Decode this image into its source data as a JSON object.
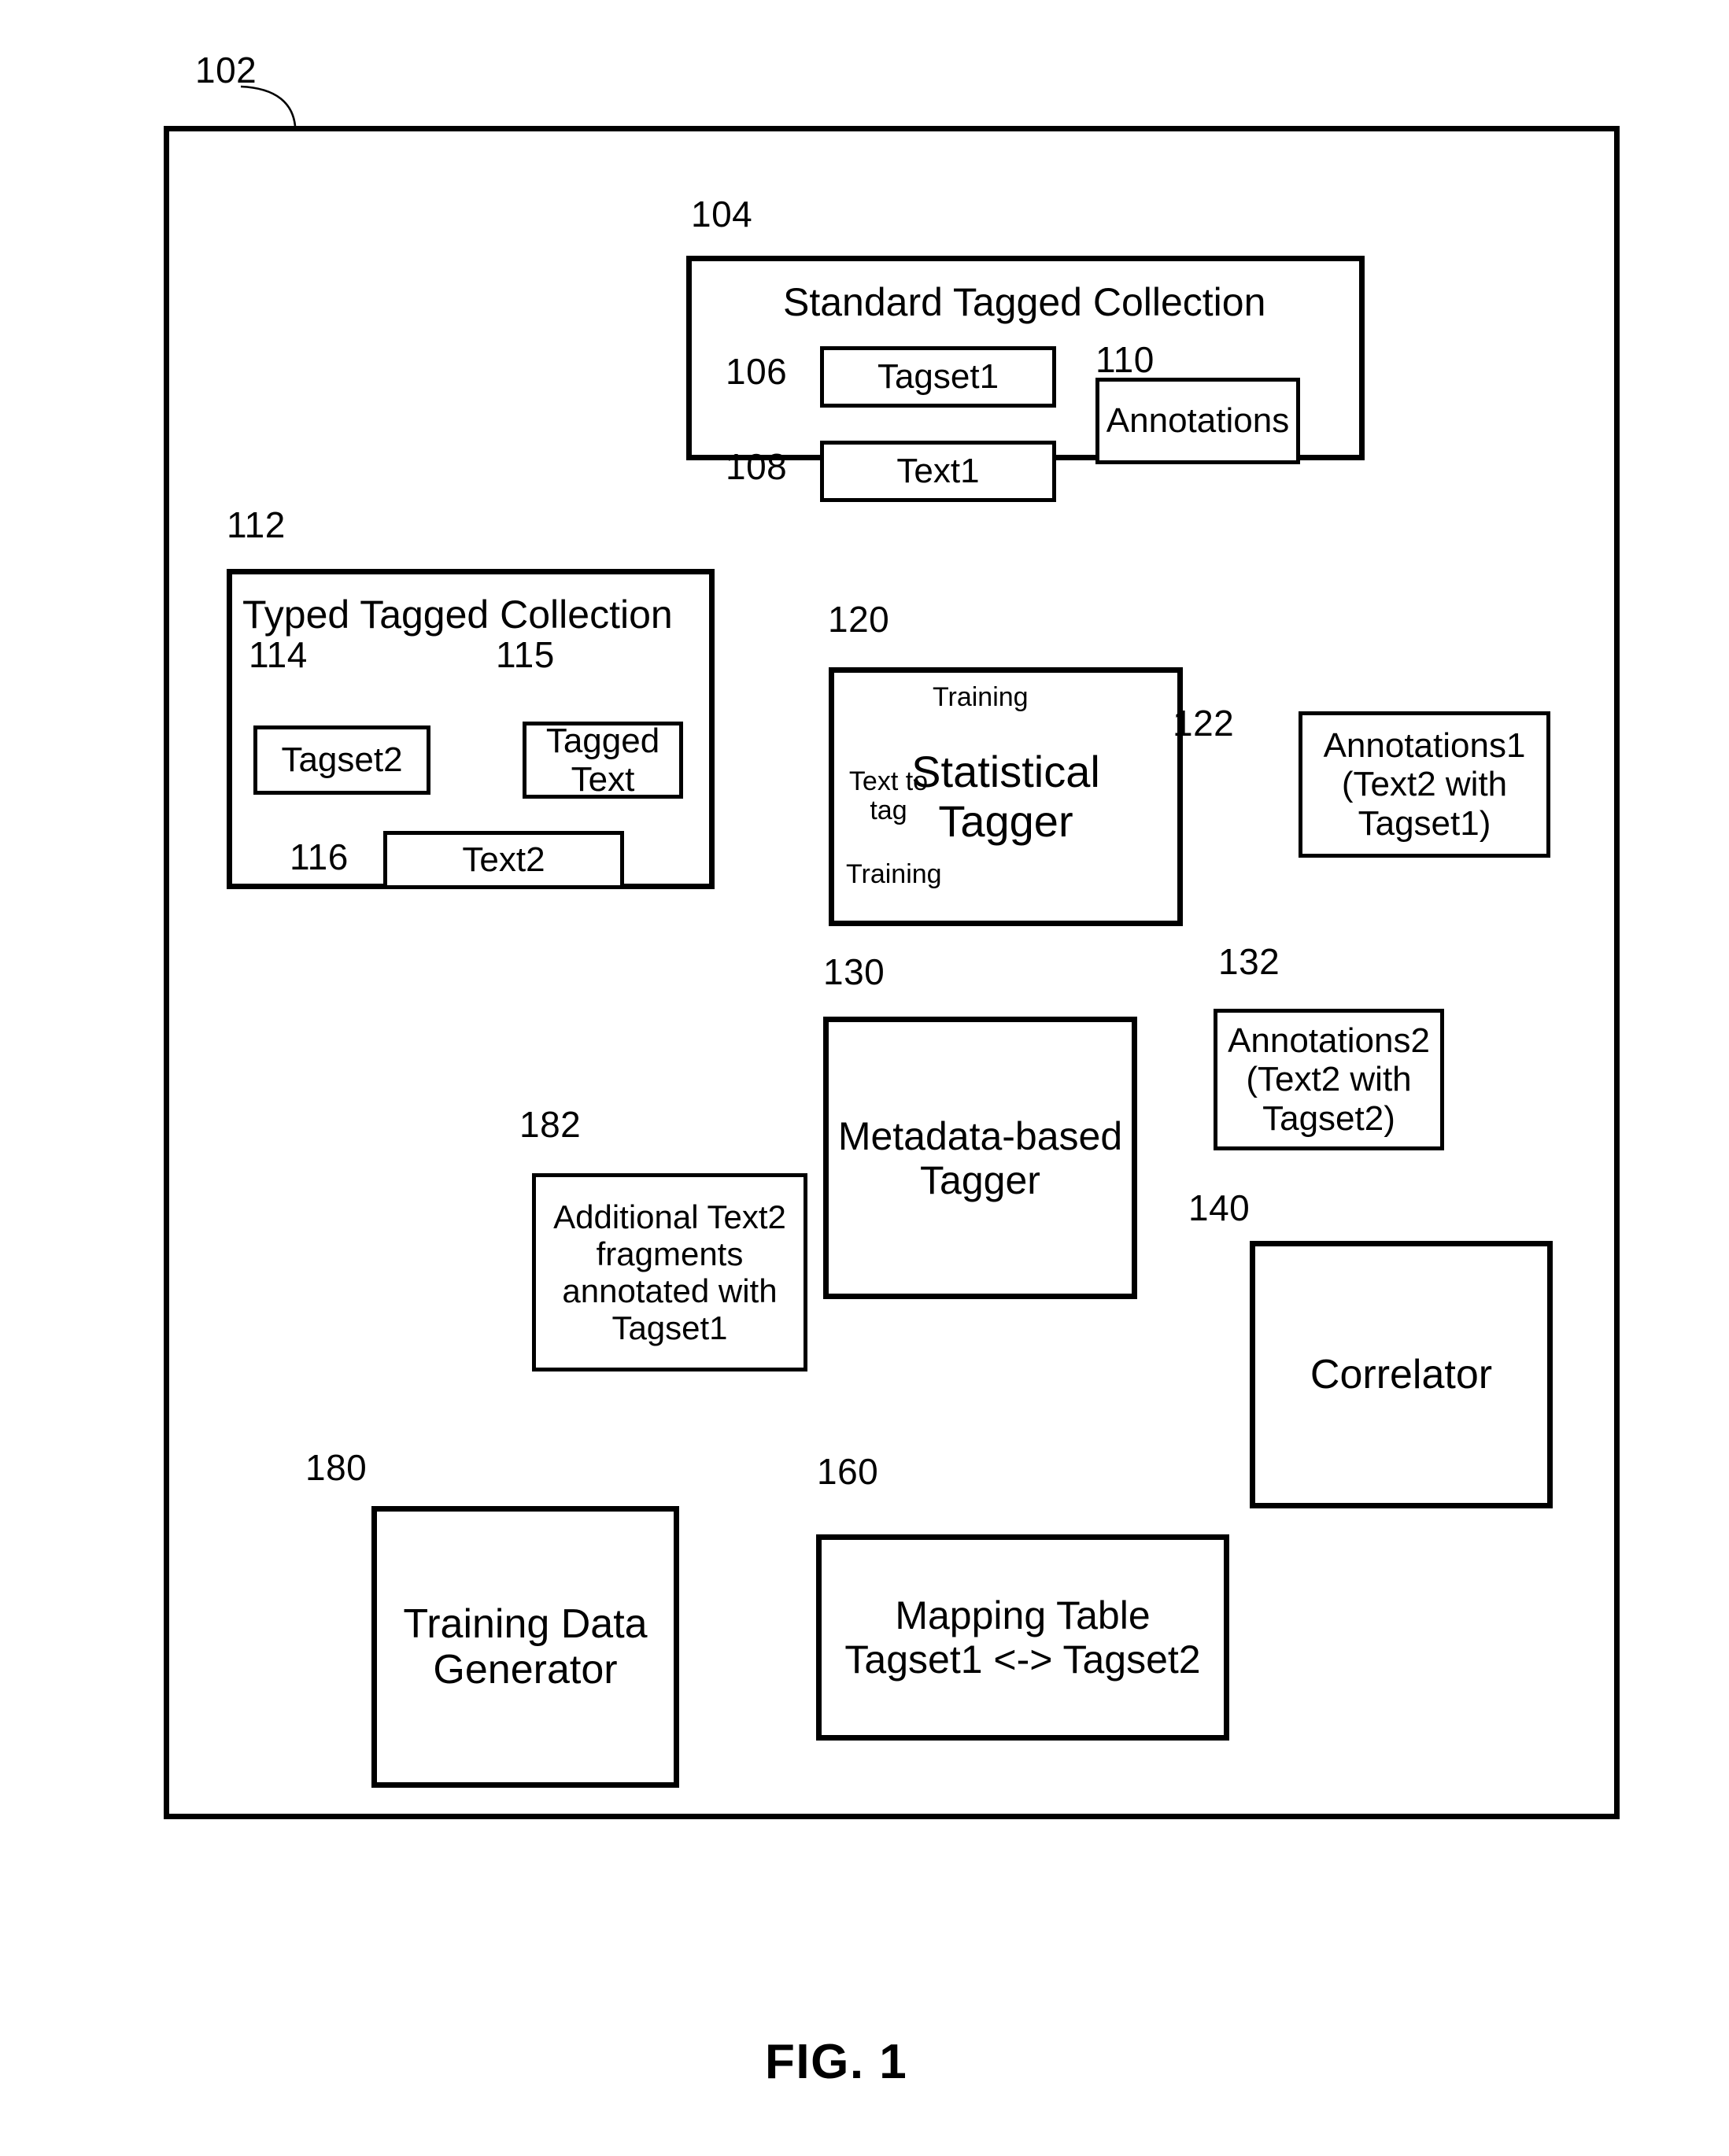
{
  "figure": {
    "caption": "FIG. 1",
    "outer_ref": "102"
  },
  "blocks": {
    "standard_collection": {
      "ref": "104",
      "title": "Standard  Tagged Collection",
      "children": [
        {
          "ref": "106",
          "label": "Tagset1"
        },
        {
          "ref": "108",
          "label": "Text1"
        },
        {
          "ref": "110",
          "label": "Annotations"
        }
      ]
    },
    "typed_collection": {
      "ref": "112",
      "title": "Typed  Tagged Collection",
      "children": [
        {
          "ref": "114",
          "label": "Tagset2"
        },
        {
          "ref": "115",
          "label": "Tagged\nText"
        },
        {
          "ref": "116",
          "label": "Text2"
        }
      ]
    },
    "statistical_tagger": {
      "ref": "120",
      "label": "Statistical\nTagger",
      "port_training_top": "Training",
      "port_text_to_tag": "Text to\ntag",
      "port_training_bottom": "Training"
    },
    "annotations1": {
      "ref": "122",
      "label": "Annotations1\n(Text2 with\nTagset1)"
    },
    "metadata_tagger": {
      "ref": "130",
      "label": "Metadata-based\nTagger"
    },
    "annotations2": {
      "ref": "132",
      "label": "Annotations2\n(Text2 with\nTagset2)"
    },
    "correlator": {
      "ref": "140",
      "label": "Correlator"
    },
    "mapping_table": {
      "ref": "160",
      "label": "Mapping Table\nTagset1 <-> Tagset2"
    },
    "training_data_generator": {
      "ref": "180",
      "label": "Training Data\nGenerator"
    },
    "additional_fragments": {
      "ref": "182",
      "label": "Additional Text2\nfragments\nannotated with\nTagset1"
    }
  },
  "colors": {
    "stroke": "#000000",
    "background": "#ffffff"
  }
}
